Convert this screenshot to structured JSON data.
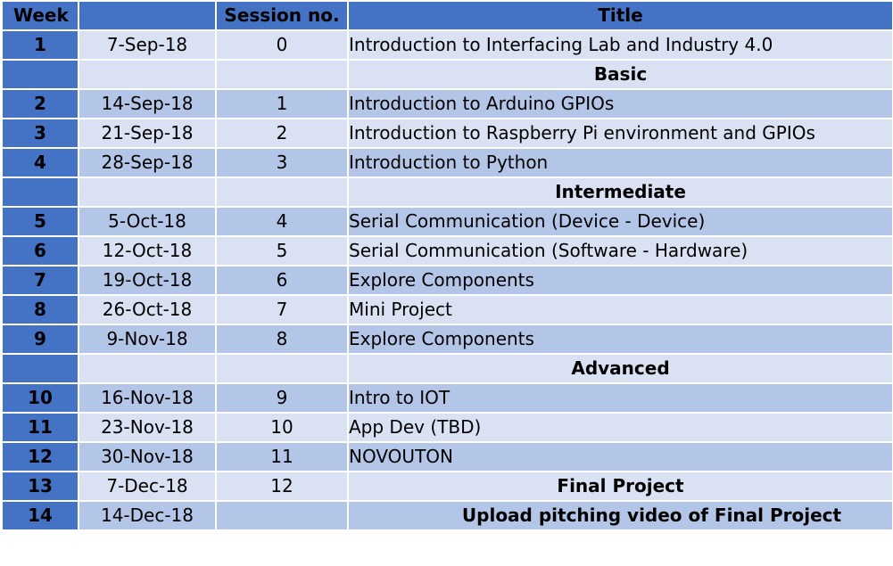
{
  "headers": {
    "week": "Week",
    "date": "",
    "session": "Session no.",
    "title": "Title"
  },
  "rows": [
    {
      "week": "1",
      "date": "7-Sep-18",
      "session": "0",
      "title": "Introduction to Interfacing Lab and Industry 4.0",
      "title_style": "normal",
      "shade": "light"
    },
    {
      "week": "",
      "date": "",
      "session": "",
      "title": "Basic",
      "title_style": "section",
      "shade": "light"
    },
    {
      "week": "2",
      "date": "14-Sep-18",
      "session": "1",
      "title": "Introduction to Arduino GPIOs",
      "title_style": "normal",
      "shade": "dark"
    },
    {
      "week": "3",
      "date": "21-Sep-18",
      "session": "2",
      "title": "Introduction to Raspberry Pi environment and GPIOs",
      "title_style": "normal",
      "shade": "light"
    },
    {
      "week": "4",
      "date": "28-Sep-18",
      "session": "3",
      "title": "Introduction to Python",
      "title_style": "normal",
      "shade": "dark"
    },
    {
      "week": "",
      "date": "",
      "session": "",
      "title": "Intermediate",
      "title_style": "section",
      "shade": "light"
    },
    {
      "week": "5",
      "date": "5-Oct-18",
      "session": "4",
      "title": "Serial Communication (Device - Device)",
      "title_style": "normal",
      "shade": "dark"
    },
    {
      "week": "6",
      "date": "12-Oct-18",
      "session": "5",
      "title": "Serial Communication (Software - Hardware)",
      "title_style": "normal",
      "shade": "light"
    },
    {
      "week": "7",
      "date": "19-Oct-18",
      "session": "6",
      "title": "Explore Components",
      "title_style": "normal",
      "shade": "dark"
    },
    {
      "week": "8",
      "date": "26-Oct-18",
      "session": "7",
      "title": "Mini Project",
      "title_style": "normal",
      "shade": "light"
    },
    {
      "week": "9",
      "date": "9-Nov-18",
      "session": "8",
      "title": "Explore Components",
      "title_style": "normal",
      "shade": "dark"
    },
    {
      "week": "",
      "date": "",
      "session": "",
      "title": "Advanced",
      "title_style": "section",
      "shade": "light"
    },
    {
      "week": "10",
      "date": "16-Nov-18",
      "session": "9",
      "title": "Intro to IOT",
      "title_style": "normal",
      "shade": "dark"
    },
    {
      "week": "11",
      "date": "23-Nov-18",
      "session": "10",
      "title": "App Dev (TBD)",
      "title_style": "normal",
      "shade": "light"
    },
    {
      "week": "12",
      "date": "30-Nov-18",
      "session": "11",
      "title": "NOVOUTON",
      "title_style": "normal",
      "shade": "dark"
    },
    {
      "week": "13",
      "date": "7-Dec-18",
      "session": "12",
      "title": "Final Project",
      "title_style": "section",
      "shade": "light"
    },
    {
      "week": "14",
      "date": "14-Dec-18",
      "session": "",
      "title": "Upload pitching video of Final Project",
      "title_style": "section-wide",
      "shade": "dark"
    }
  ],
  "colors": {
    "header": "#4472c4",
    "row_light": "#d9e1f2",
    "row_dark": "#b4c6e7"
  }
}
